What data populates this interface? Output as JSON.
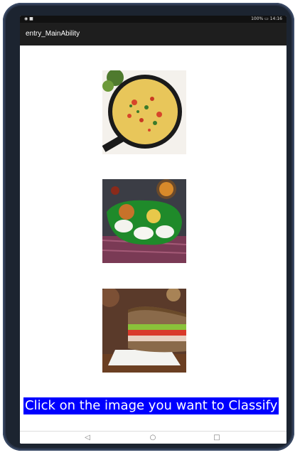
{
  "app": {
    "title": "entry_MainAbility"
  },
  "status": {
    "left": "◉ ■",
    "right": "100% ▭ 14:16"
  },
  "images": [
    {
      "name": "omelette-image",
      "icon": "omelette"
    },
    {
      "name": "idli-sambar-image",
      "icon": "idli-sambar"
    },
    {
      "name": "sandwich-image",
      "icon": "sandwich"
    }
  ],
  "prompt": {
    "text": "Click on the image you want to Classify"
  },
  "nav": {
    "back": "◁",
    "home": "○",
    "recents": "□"
  },
  "colors": {
    "prompt_bg": "#0000ff",
    "prompt_fg": "#ffffff",
    "appbar_bg": "#1e1e1e"
  }
}
